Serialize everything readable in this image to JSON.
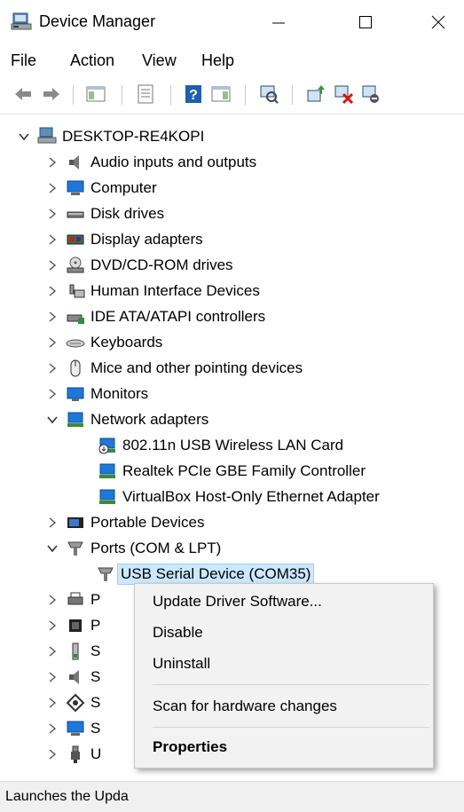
{
  "window": {
    "title": "Device Manager"
  },
  "menu": {
    "file": "File",
    "action": "Action",
    "view": "View",
    "help": "Help"
  },
  "tree": {
    "root": "DESKTOP-RE4KOPI",
    "audio": "Audio inputs and outputs",
    "computer": "Computer",
    "disk": "Disk drives",
    "display": "Display adapters",
    "dvd": "DVD/CD-ROM drives",
    "hid": "Human Interface Devices",
    "ide": "IDE ATA/ATAPI controllers",
    "keyboards": "Keyboards",
    "mice": "Mice and other pointing devices",
    "monitors": "Monitors",
    "network": "Network adapters",
    "net_children": [
      "802.11n USB Wireless LAN Card",
      "Realtek PCIe GBE Family Controller",
      "VirtualBox Host-Only Ethernet Adapter"
    ],
    "portable": "Portable Devices",
    "ports": "Ports (COM & LPT)",
    "usb_serial": "USB Serial Device (COM35)",
    "partial": [
      "P",
      "P",
      "S",
      "S",
      "S",
      "S",
      "U"
    ]
  },
  "context_menu": {
    "update": "Update Driver Software...",
    "disable": "Disable",
    "uninstall": "Uninstall",
    "scan": "Scan for hardware changes",
    "properties": "Properties"
  },
  "status_bar": {
    "text": "Launches the Upda"
  },
  "colors": {
    "selection": "#cce8ff",
    "menu_bg": "#f2f2f2",
    "icon_blue": "#1e78d7"
  }
}
